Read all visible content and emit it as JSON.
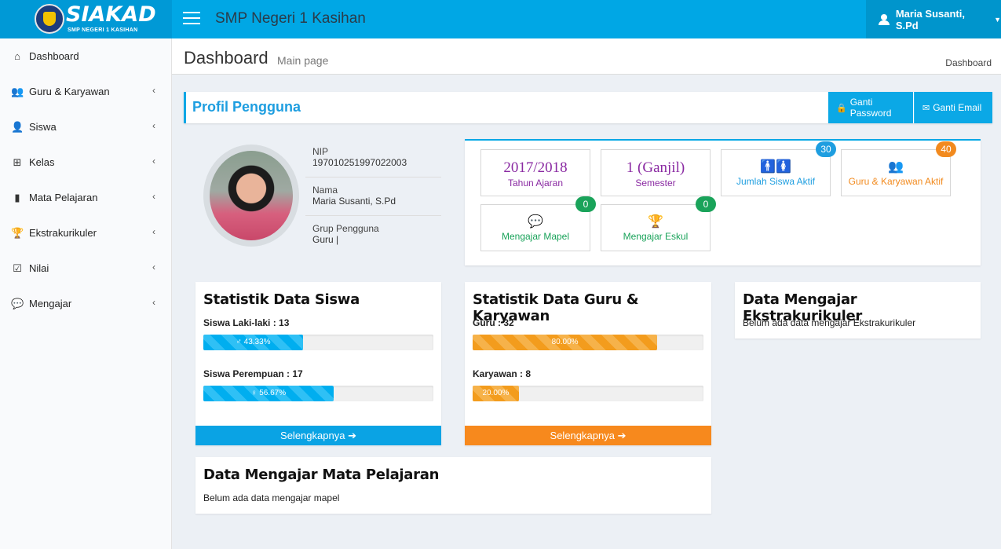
{
  "brand": {
    "name": "SIAKAD",
    "sub": "SMP NEGERI 1 KASIHAN"
  },
  "header": {
    "school": "SMP Negeri 1 Kasihan",
    "user": "Maria Susanti, S.Pd"
  },
  "sidebar": {
    "items": [
      {
        "label": "Dashboard",
        "icon": "home-icon",
        "glyph": "⌂",
        "chevron": ""
      },
      {
        "label": "Guru & Karyawan",
        "icon": "users-icon",
        "glyph": "👥",
        "chevron": "‹"
      },
      {
        "label": "Siswa",
        "icon": "user-icon",
        "glyph": "👤",
        "chevron": "‹"
      },
      {
        "label": "Kelas",
        "icon": "sitemap-icon",
        "glyph": "⊞",
        "chevron": "‹"
      },
      {
        "label": "Mata Pelajaran",
        "icon": "book-icon",
        "glyph": "▮",
        "chevron": "‹"
      },
      {
        "label": "Ekstrakurikuler",
        "icon": "trophy-icon",
        "glyph": "🏆",
        "chevron": "‹"
      },
      {
        "label": "Nilai",
        "icon": "check-square-icon",
        "glyph": "☑",
        "chevron": "‹"
      },
      {
        "label": "Mengajar",
        "icon": "comments-icon",
        "glyph": "💬",
        "chevron": "‹"
      }
    ]
  },
  "content_header": {
    "title": "Dashboard",
    "subtitle": "Main page",
    "breadcrumb": "Dashboard"
  },
  "profile": {
    "title": "Profil Pengguna",
    "btn_password": "Ganti Password",
    "btn_email": "Ganti Email",
    "nip_label": "NIP",
    "nip": "197010251997022003",
    "nama_label": "Nama",
    "nama": "Maria Susanti, S.Pd",
    "grup_label": "Grup Pengguna",
    "grup": "Guru |"
  },
  "tiles": {
    "tahun": {
      "value": "2017/2018",
      "label": "Tahun Ajaran"
    },
    "semester": {
      "value": "1 (Ganjil)",
      "label": "Semester"
    },
    "siswa": {
      "label": "Jumlah Siswa Aktif",
      "badge": "30"
    },
    "guru": {
      "label": "Guru & Karyawan Aktif",
      "badge": "40"
    },
    "mapel": {
      "label": "Mengajar Mapel",
      "badge": "0"
    },
    "eskul": {
      "label": "Mengajar Eskul",
      "badge": "0"
    }
  },
  "stat_siswa": {
    "title": "Statistik Data Siswa",
    "laki_label": "Siswa Laki-laki : 13",
    "laki_pct": "43.33%",
    "laki_frac": 0.4333,
    "perempuan_label": "Siswa Perempuan : 17",
    "perempuan_pct": "56.67%",
    "perempuan_frac": 0.5667,
    "more": "Selengkapnya"
  },
  "stat_guru": {
    "title": "Statistik Data Guru & Karyawan",
    "guru_label": "Guru : 32",
    "guru_pct": "80.00%",
    "guru_frac": 0.8,
    "karyawan_label": "Karyawan : 8",
    "karyawan_pct": "20.00%",
    "karyawan_frac": 0.2,
    "more": "Selengkapnya"
  },
  "eskul_box": {
    "title": "Data Mengajar Ekstrakurikuler",
    "desc": "Belum ada data mengajar Ekstrakurikuler"
  },
  "mapel_box": {
    "title": "Data Mengajar Mata Pelajaran",
    "desc": "Belum ada data mengajar mapel"
  }
}
